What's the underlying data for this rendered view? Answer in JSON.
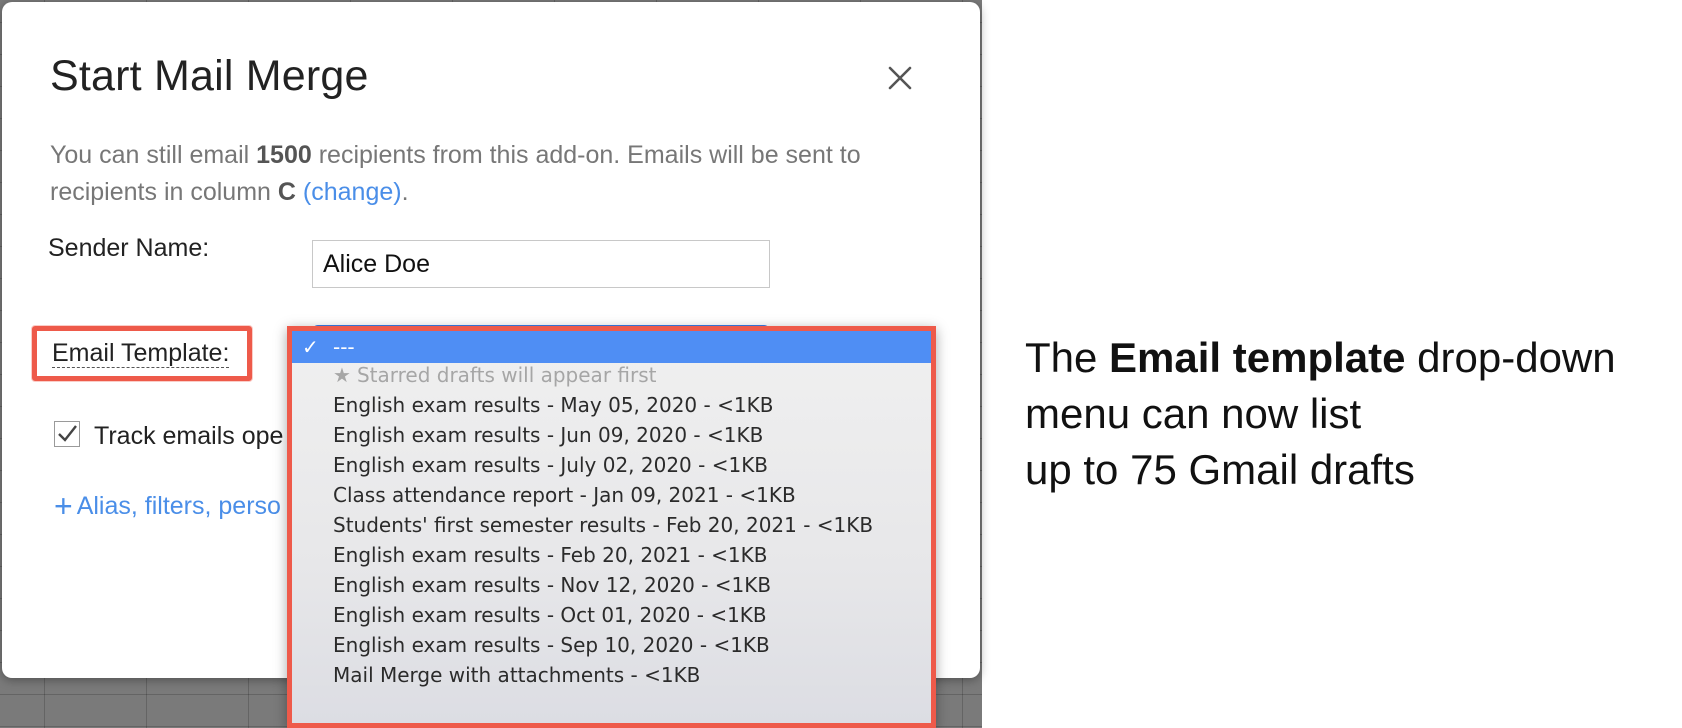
{
  "dialog": {
    "title": "Start Mail Merge",
    "intro": {
      "part1": "You can still email ",
      "count": "1500",
      "part2": " recipients from this add-on. Emails will be sent to recipients in column ",
      "column": "C",
      "change_link": "(change)",
      "period": "."
    },
    "sender": {
      "label": "Sender Name:",
      "value": "Alice Doe"
    },
    "template": {
      "label": "Email Template:"
    },
    "track": {
      "label": "Track emails ope",
      "checked": true
    },
    "advanced_link": "Alias, filters, perso"
  },
  "dropdown": {
    "selected": "---",
    "options": [
      {
        "label": "---",
        "state": "selected"
      },
      {
        "label": "Starred drafts will appear first",
        "state": "disabled",
        "icon": "star-icon"
      },
      {
        "label": "English exam results - May 05, 2020 - <1KB"
      },
      {
        "label": "English exam results - Jun 09, 2020 - <1KB"
      },
      {
        "label": "English exam results - July 02, 2020 - <1KB"
      },
      {
        "label": "Class attendance report - Jan 09, 2021 - <1KB"
      },
      {
        "label": "Students' first semester results - Feb 20, 2021 - <1KB"
      },
      {
        "label": "English exam results - Feb 20, 2021 - <1KB"
      },
      {
        "label": "English exam results - Nov 12, 2020 - <1KB"
      },
      {
        "label": "English exam results - Oct 01, 2020 - <1KB"
      },
      {
        "label": "English exam results - Sep 10, 2020 - <1KB"
      },
      {
        "label": "Mail Merge with attachments - <1KB"
      }
    ]
  },
  "annotation": {
    "prefix": "The ",
    "bold": "Email template",
    "line1_rest": " drop-down",
    "line2": "menu can now list",
    "line3": "up to 75 Gmail drafts"
  },
  "colors": {
    "highlight": "#ee5a4a",
    "link": "#4a8ee8",
    "selected_option": "#4f8ef4"
  }
}
